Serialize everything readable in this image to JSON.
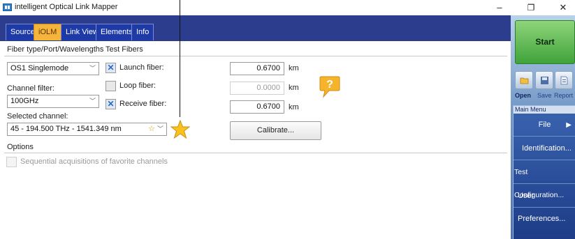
{
  "window": {
    "title": "intelligent Optical Link Mapper",
    "controls": {
      "minimize": "–",
      "restore": "❐",
      "close": "✕"
    }
  },
  "tabs": [
    {
      "label": "Source",
      "active": false
    },
    {
      "label": "iOLM",
      "active": true
    },
    {
      "label": "Link View",
      "active": false
    },
    {
      "label": "Elements",
      "active": false
    },
    {
      "label": "Info",
      "active": false
    }
  ],
  "subtabs": {
    "fiber_type": "Fiber type/Port/Wavelengths",
    "test_fibers": "Test Fibers"
  },
  "fiber_type": {
    "value": "OS1 Singlemode"
  },
  "channel_filter": {
    "label": "Channel filter:",
    "value": "100GHz"
  },
  "selected_channel": {
    "label": "Selected channel:",
    "value": "45  - 194.500 THz - 1541.349 nm"
  },
  "launch_fiber": {
    "label": "Launch fiber:",
    "checked": true,
    "value": "0.6700",
    "unit": "km"
  },
  "loop_fiber": {
    "label": "Loop fiber:",
    "checked": false,
    "value": "0.0000",
    "unit": "km"
  },
  "receive_fiber": {
    "label": "Receive fiber:",
    "checked": true,
    "value": "0.6700",
    "unit": "km"
  },
  "calibrate_label": "Calibrate...",
  "options": {
    "title": "Options",
    "sequential_label": "Sequential acquisitions of favorite channels",
    "sequential_checked": false
  },
  "colors": {
    "accent_tab": "#f5b43a",
    "tab_bar": "#2b3d8c",
    "start_green": "#3fa33a",
    "star": "#f6c21b"
  },
  "sidebar": {
    "start_label": "Start",
    "tools": [
      {
        "icon": "open-folder-icon",
        "label": "Open"
      },
      {
        "icon": "save-icon",
        "label": "Save"
      },
      {
        "icon": "report-icon",
        "label": "Report"
      }
    ],
    "menu_header": "Main Menu",
    "menu_items": [
      {
        "label": "File",
        "arrow": "▶"
      },
      {
        "label": "Identification..."
      },
      {
        "label": "Test Configuration..."
      },
      {
        "label": "User Preferences..."
      }
    ]
  }
}
